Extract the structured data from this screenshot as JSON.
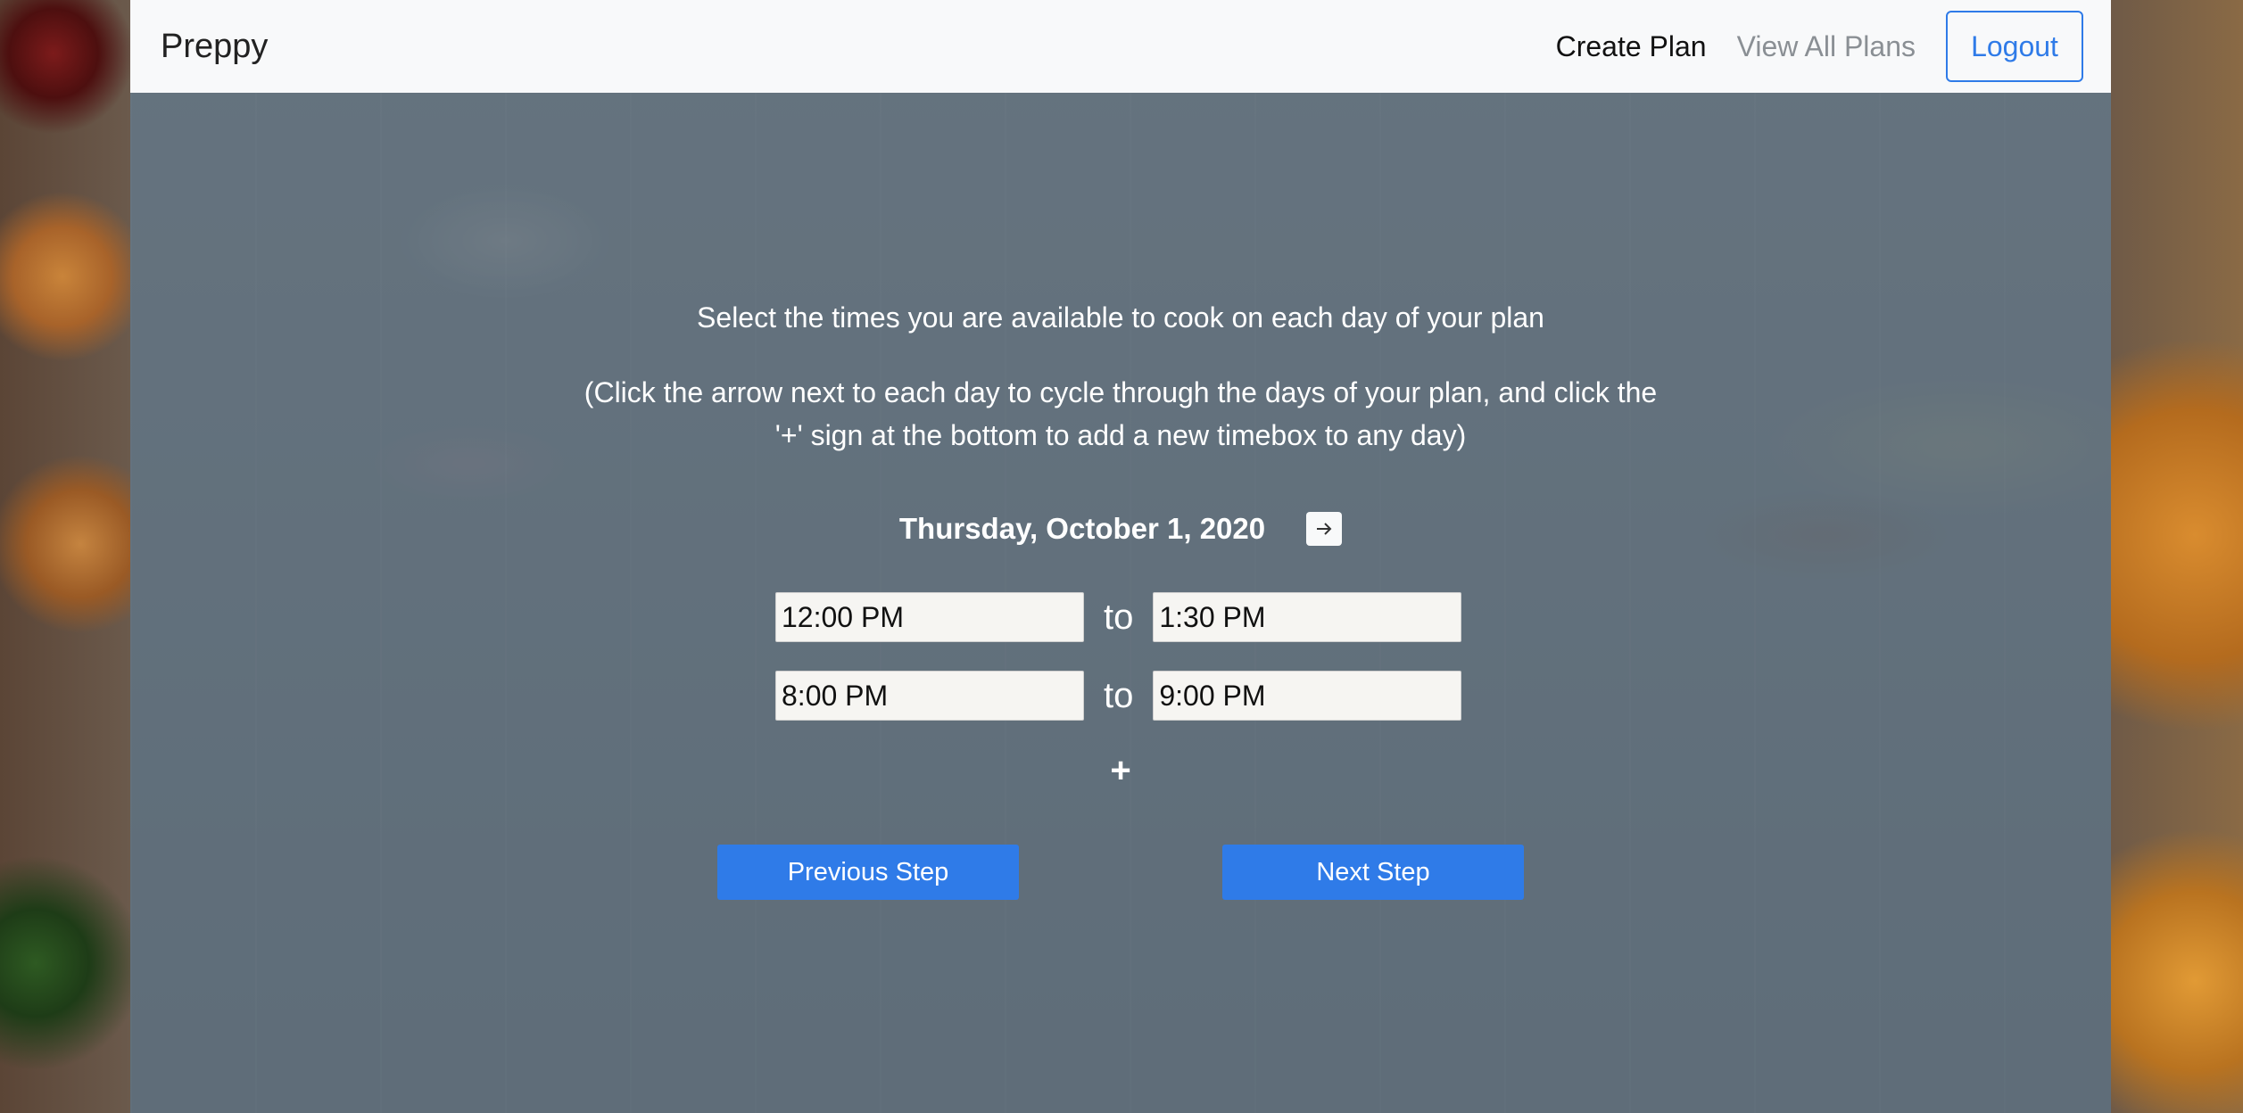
{
  "navbar": {
    "brand": "Preppy",
    "links": [
      "Create Plan",
      "View All Plans"
    ],
    "logout_label": "Logout"
  },
  "main": {
    "instruction": "Select the times you are available to cook on each day of your plan",
    "hint": "(Click the arrow next to each day to cycle through the days of your plan, and click the '+' sign at the bottom to add a new timebox to any day)",
    "day_label": "Thursday, October 1, 2020",
    "next_day_icon": "arrow-right-icon",
    "timeboxes": [
      {
        "start": "12:00 PM",
        "separator": "to",
        "end": "1:30 PM"
      },
      {
        "start": "8:00 PM",
        "separator": "to",
        "end": "9:00 PM"
      }
    ],
    "add_timebox_label": "+",
    "previous_step_label": "Previous Step",
    "next_step_label": "Next Step"
  },
  "colors": {
    "accent": "#2f7be8",
    "navbar_bg": "#f8f9fa",
    "overlay": "#5f6d78"
  }
}
